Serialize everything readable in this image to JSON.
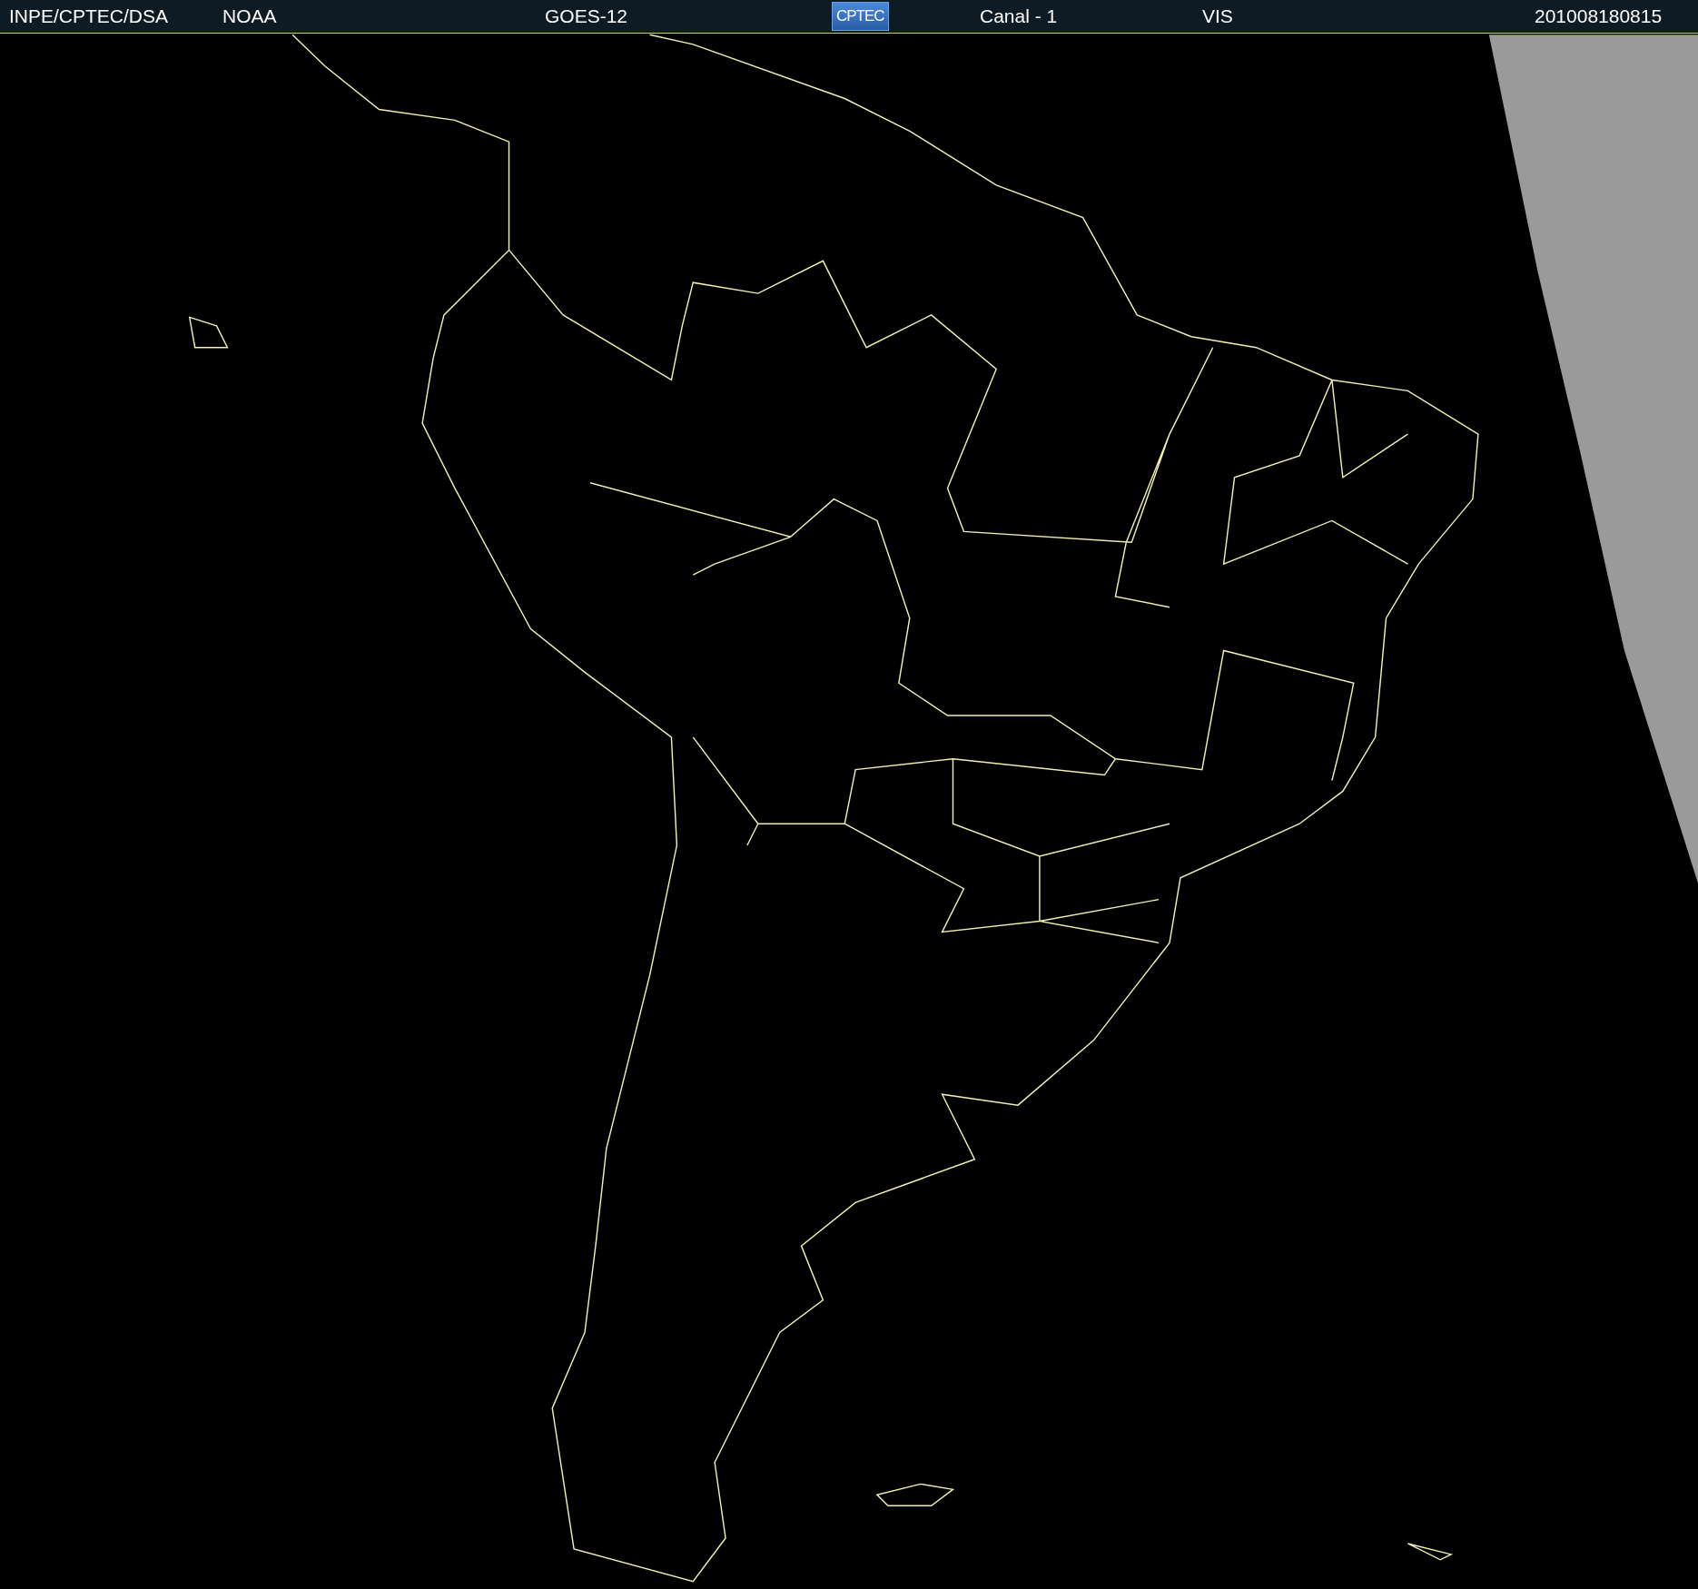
{
  "header": {
    "items": [
      {
        "kind": "text",
        "text": "INPE/CPTEC/DSA"
      },
      {
        "kind": "text",
        "text": "NOAA"
      },
      {
        "kind": "text",
        "text": "GOES-12"
      },
      {
        "kind": "logo",
        "text": "CPTEC"
      },
      {
        "kind": "text",
        "text": "Canal - 1"
      },
      {
        "kind": "text",
        "text": "VIS"
      },
      {
        "kind": "text",
        "text": "201008180815"
      }
    ]
  }
}
